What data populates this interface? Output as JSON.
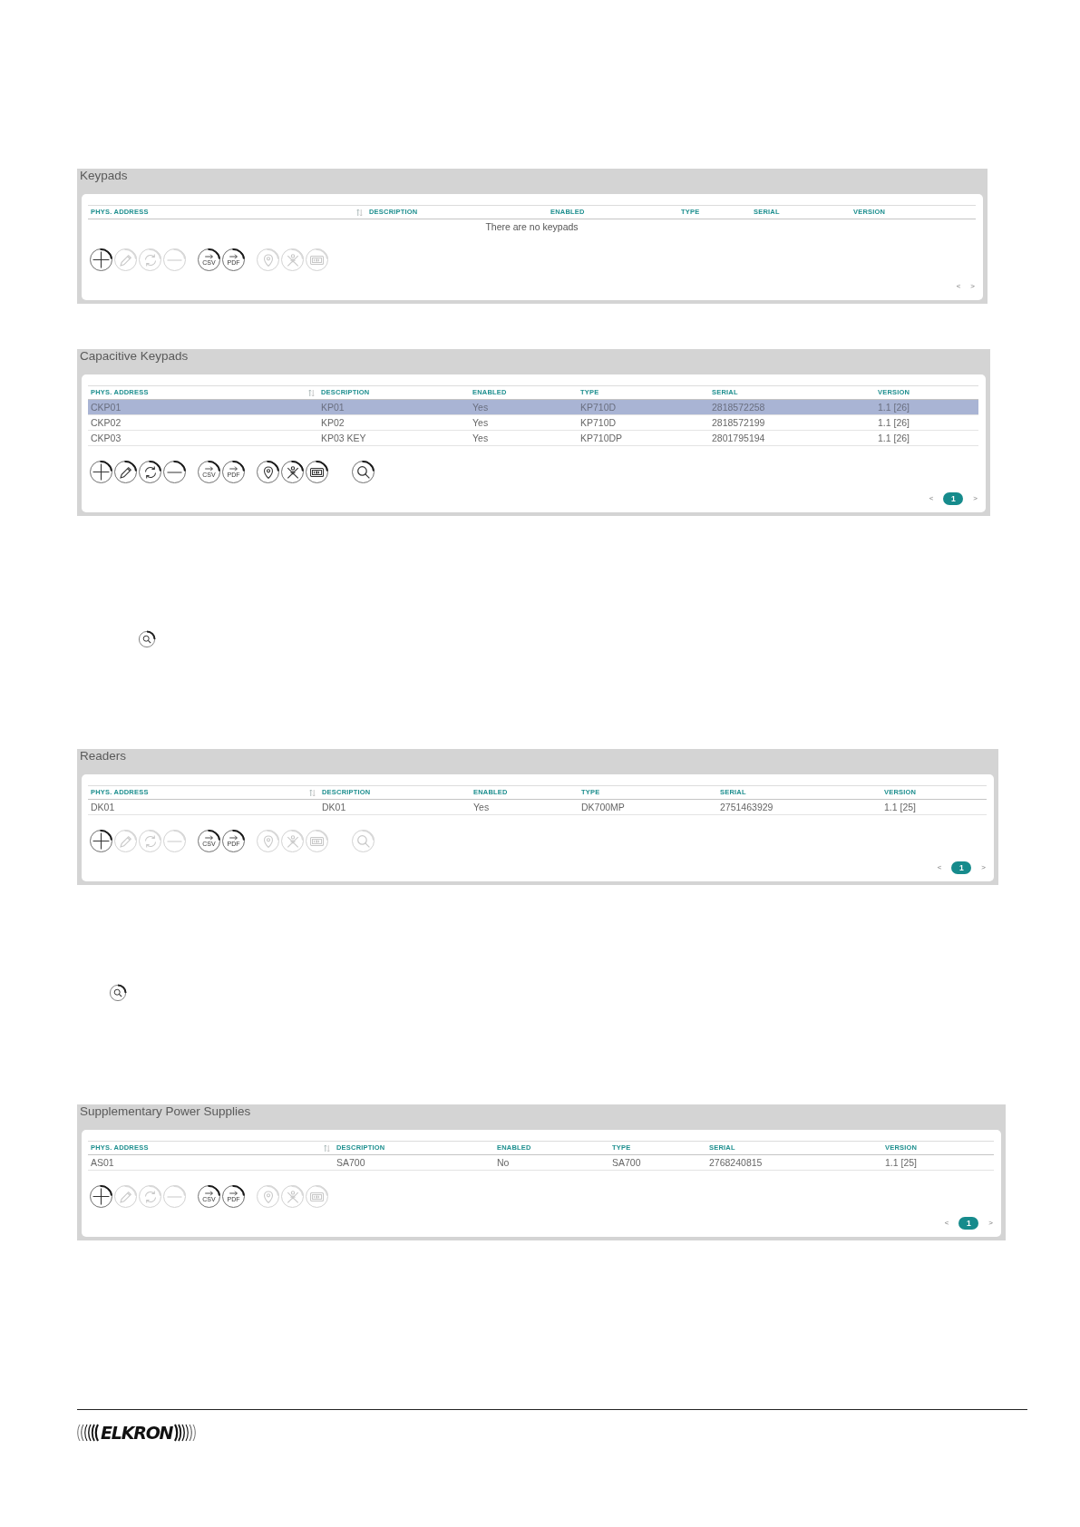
{
  "sections": [
    {
      "kind": "panel",
      "title": "Keypads",
      "columns": [
        {
          "label": "PHYS. ADDRESS",
          "sortable": true
        },
        {
          "label": "DESCRIPTION",
          "sortable": false
        },
        {
          "label": "ENABLED",
          "sortable": false
        },
        {
          "label": "TYPE",
          "sortable": false
        },
        {
          "label": "SERIAL",
          "sortable": false
        },
        {
          "label": "VERSION",
          "sortable": false
        }
      ],
      "empty_message": "There are no keypads",
      "toolbar": [
        [
          {
            "kind": "add",
            "disabled": false
          },
          {
            "kind": "edit",
            "disabled": true
          },
          {
            "kind": "refresh",
            "disabled": true
          },
          {
            "kind": "remove",
            "disabled": true
          }
        ],
        [
          {
            "kind": "export",
            "label": "CSV",
            "disabled": false
          },
          {
            "kind": "export",
            "label": "PDF",
            "disabled": false
          }
        ],
        [
          {
            "kind": "locate",
            "disabled": true
          },
          {
            "kind": "cross",
            "disabled": true
          },
          {
            "kind": "display",
            "disabled": true
          }
        ]
      ],
      "pagination": {
        "prev": "<",
        "next": ">"
      }
    },
    {
      "kind": "panel",
      "title": "Capacitive Keypads",
      "columns": [
        {
          "label": "PHYS. ADDRESS",
          "sortable": true
        },
        {
          "label": "DESCRIPTION",
          "sortable": false
        },
        {
          "label": "ENABLED",
          "sortable": false
        },
        {
          "label": "TYPE",
          "sortable": false
        },
        {
          "label": "SERIAL",
          "sortable": false
        },
        {
          "label": "VERSION",
          "sortable": false
        }
      ],
      "rows": [
        {
          "cells": [
            "CKP01",
            "KP01",
            "Yes",
            "KP710D",
            "2818572258",
            "1.1 [26]"
          ],
          "selected": true
        },
        {
          "cells": [
            "CKP02",
            "KP02",
            "Yes",
            "KP710D",
            "2818572199",
            "1.1 [26]"
          ],
          "selected": false
        },
        {
          "cells": [
            "CKP03",
            "KP03 KEY",
            "Yes",
            "KP710DP",
            "2801795194",
            "1.1 [26]"
          ],
          "selected": false
        }
      ],
      "toolbar": [
        [
          {
            "kind": "add",
            "disabled": false
          },
          {
            "kind": "edit",
            "disabled": false
          },
          {
            "kind": "refresh",
            "disabled": false
          },
          {
            "kind": "remove",
            "disabled": false
          }
        ],
        [
          {
            "kind": "export",
            "label": "CSV",
            "disabled": false
          },
          {
            "kind": "export",
            "label": "PDF",
            "disabled": false
          }
        ],
        [
          {
            "kind": "locate",
            "disabled": false
          },
          {
            "kind": "cross",
            "disabled": false
          },
          {
            "kind": "display",
            "disabled": false
          }
        ],
        [
          {
            "kind": "search",
            "disabled": false
          }
        ]
      ],
      "pagination": {
        "prev": "<",
        "next": ">",
        "pages": [
          {
            "label": "1",
            "selected": true
          }
        ]
      }
    },
    {
      "kind": "search_icon"
    },
    {
      "kind": "panel",
      "title": "Readers",
      "columns": [
        {
          "label": "PHYS. ADDRESS",
          "sortable": true
        },
        {
          "label": "DESCRIPTION",
          "sortable": false
        },
        {
          "label": "ENABLED",
          "sortable": false
        },
        {
          "label": "TYPE",
          "sortable": false
        },
        {
          "label": "SERIAL",
          "sortable": false
        },
        {
          "label": "VERSION",
          "sortable": false
        }
      ],
      "rows": [
        {
          "cells": [
            "DK01",
            "DK01",
            "Yes",
            "DK700MP",
            "2751463929",
            "1.1 [25]"
          ],
          "selected": false
        }
      ],
      "toolbar": [
        [
          {
            "kind": "add",
            "disabled": false
          },
          {
            "kind": "edit",
            "disabled": true
          },
          {
            "kind": "refresh",
            "disabled": true
          },
          {
            "kind": "remove",
            "disabled": true
          }
        ],
        [
          {
            "kind": "export",
            "label": "CSV",
            "disabled": false
          },
          {
            "kind": "export",
            "label": "PDF",
            "disabled": false
          }
        ],
        [
          {
            "kind": "locate",
            "disabled": true
          },
          {
            "kind": "cross",
            "disabled": true
          },
          {
            "kind": "display",
            "disabled": true
          }
        ],
        [
          {
            "kind": "search",
            "disabled": true
          }
        ]
      ],
      "pagination": {
        "prev": "<",
        "next": ">",
        "pages": [
          {
            "label": "1",
            "selected": true
          }
        ]
      }
    },
    {
      "kind": "search_icon"
    },
    {
      "kind": "panel",
      "title": "Supplementary Power Supplies",
      "columns": [
        {
          "label": "PHYS. ADDRESS",
          "sortable": true
        },
        {
          "label": "DESCRIPTION",
          "sortable": false
        },
        {
          "label": "ENABLED",
          "sortable": false
        },
        {
          "label": "TYPE",
          "sortable": false
        },
        {
          "label": "SERIAL",
          "sortable": false
        },
        {
          "label": "VERSION",
          "sortable": false
        }
      ],
      "rows": [
        {
          "cells": [
            "AS01",
            "SA700",
            "No",
            "SA700",
            "2768240815",
            "1.1 [25]"
          ],
          "selected": false
        }
      ],
      "toolbar": [
        [
          {
            "kind": "add",
            "disabled": false
          },
          {
            "kind": "edit",
            "disabled": true
          },
          {
            "kind": "refresh",
            "disabled": true
          },
          {
            "kind": "remove",
            "disabled": true
          }
        ],
        [
          {
            "kind": "export",
            "label": "CSV",
            "disabled": false
          },
          {
            "kind": "export",
            "label": "PDF",
            "disabled": false
          }
        ],
        [
          {
            "kind": "locate",
            "disabled": true
          },
          {
            "kind": "cross",
            "disabled": true
          },
          {
            "kind": "display",
            "disabled": true
          }
        ]
      ],
      "pagination": {
        "prev": "<",
        "next": ">",
        "pages": [
          {
            "label": "1",
            "selected": true
          }
        ]
      }
    }
  ],
  "footer": {
    "logo": "ELKRON"
  }
}
